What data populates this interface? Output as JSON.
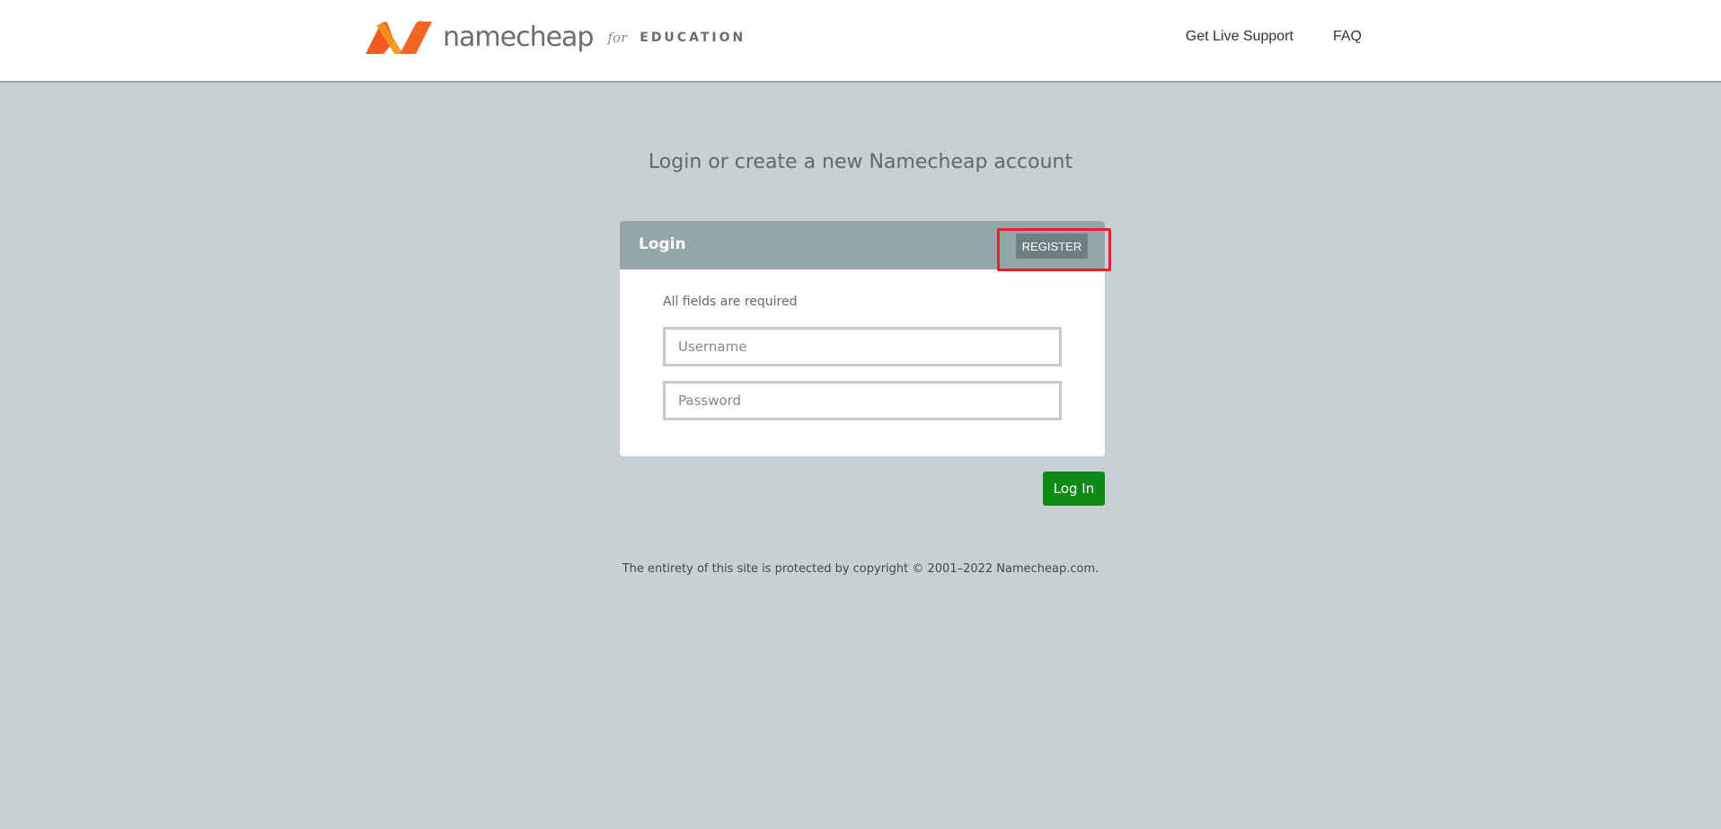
{
  "header": {
    "brand_word": "namecheap",
    "brand_for": "for",
    "brand_edu": "EDUCATION",
    "nav": [
      {
        "label": "Get Live Support"
      },
      {
        "label": "FAQ"
      }
    ]
  },
  "main": {
    "heading": "Login or create a new Namecheap account",
    "card": {
      "title": "Login",
      "register_label": "REGISTER",
      "required_note": "All fields are required",
      "username_placeholder": "Username",
      "password_placeholder": "Password"
    },
    "login_label": "Log In"
  },
  "footer": {
    "copyright": "The entirety of this site is protected by copyright © 2001–2022 Namecheap.com."
  },
  "colors": {
    "brand_orange": "#f26522",
    "header_bar": "#93a6a9",
    "login_green": "#0d8a16",
    "highlight_red": "#e8202a"
  }
}
